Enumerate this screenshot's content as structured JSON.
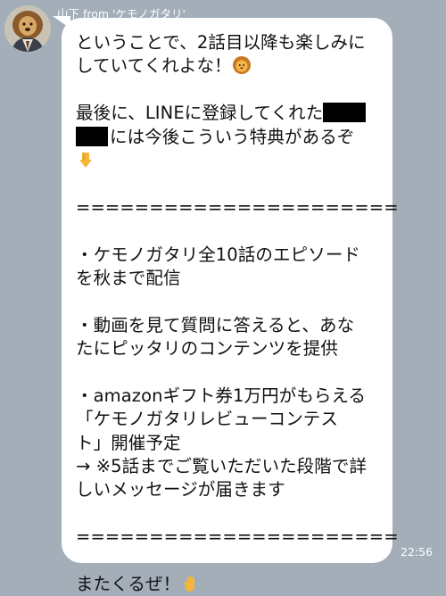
{
  "chat": {
    "sender": "山下 from 'ケモノガタリ'",
    "timestamp": "22:56",
    "message_lines": [
      "ということで、2話目以降も楽しみに",
      "していてくれよな！",
      "",
      "最後に、LINEに登録してくれた",
      "には今後こういう特典があるぞ",
      "",
      "",
      "======================",
      "",
      "・ケモノガタリ全10話のエピソード",
      "を秋まで配信",
      "",
      "・動画を見て質問に答えると、あな",
      "たにピッタリのコンテンツを提供",
      "",
      "・amazonギフト券1万円がもらえる",
      "「ケモノガタリレビューコンテス",
      "ト」開催予定",
      "→ ※5話までご覧いただいた段階で詳",
      "しいメッセージが届きます",
      "",
      "======================",
      "",
      "またくるぜ！"
    ],
    "emojis": {
      "line2": "lion-face-emoji",
      "line6": "backhand-index-pointing-down-emoji",
      "line24": "waving-hand-emoji"
    }
  },
  "colors": {
    "background": "#a3aeb9",
    "bubble": "#ffffff",
    "text": "#111111",
    "meta_text": "#ffffff"
  }
}
